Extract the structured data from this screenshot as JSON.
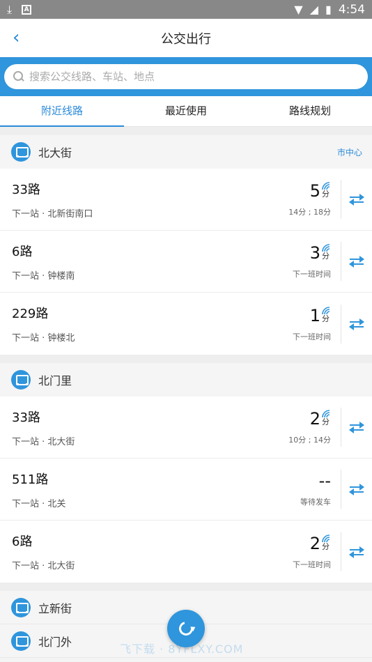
{
  "status_bar": {
    "time": "4:54"
  },
  "header": {
    "title": "公交出行",
    "back_symbol": "‹"
  },
  "search": {
    "placeholder": "搜索公交线路、车站、地点"
  },
  "tabs": [
    {
      "label": "附近线路",
      "active": true
    },
    {
      "label": "最近使用",
      "active": false
    },
    {
      "label": "路线规划",
      "active": false
    }
  ],
  "stations": [
    {
      "name": "北大街",
      "tag": "市中心",
      "routes": [
        {
          "name": "33路",
          "next": "下一站 · 北新街南口",
          "eta": "5",
          "unit": "分",
          "sub": "14分 ; 18分"
        },
        {
          "name": "6路",
          "next": "下一站 · 钟楼南",
          "eta": "3",
          "unit": "分",
          "sub": "下一班时间"
        },
        {
          "name": "229路",
          "next": "下一站 · 钟楼北",
          "eta": "1",
          "unit": "分",
          "sub": "下一班时间"
        }
      ]
    },
    {
      "name": "北门里",
      "tag": "",
      "routes": [
        {
          "name": "33路",
          "next": "下一站 · 北大街",
          "eta": "2",
          "unit": "分",
          "sub": "10分 ; 14分"
        },
        {
          "name": "511路",
          "next": "下一站 · 北关",
          "eta": "--",
          "unit": "",
          "sub": "等待发车"
        },
        {
          "name": "6路",
          "next": "下一站 · 北大街",
          "eta": "2",
          "unit": "分",
          "sub": "下一班时间"
        }
      ]
    }
  ],
  "more_stations": [
    "立新街",
    "北门外"
  ],
  "watermark": "飞下载 · 8YFLXY.COM",
  "colors": {
    "accent": "#2f95dc",
    "link": "#2b8ad8"
  }
}
